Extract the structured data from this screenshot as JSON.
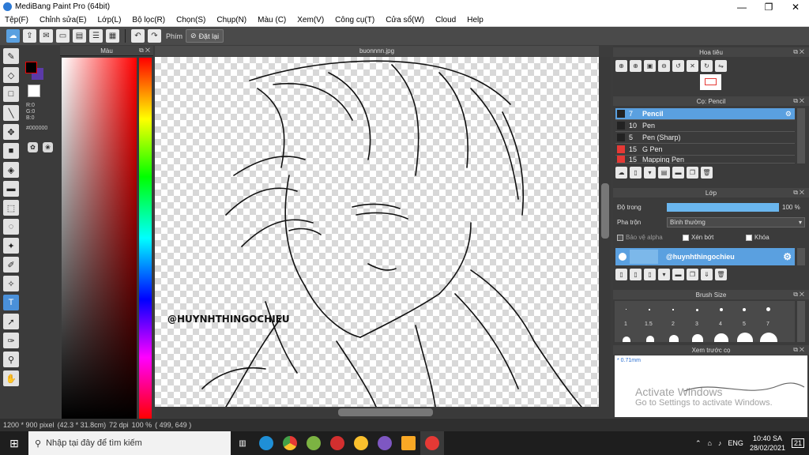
{
  "window": {
    "title": "MediBang Paint Pro (64bit)",
    "minimize": "—",
    "maximize": "❐",
    "close": "✕"
  },
  "menu": [
    "Tệp(F)",
    "Chỉnh sửa(E)",
    "Lớp(L)",
    "Bộ lọc(R)",
    "Chọn(S)",
    "Chụp(N)",
    "Màu (C)",
    "Xem(V)",
    "Công cụ(T)",
    "Cửa sổ(W)",
    "Cloud",
    "Help"
  ],
  "toolbar": {
    "mode_label": "Phím",
    "reset_label": "Đặt lại"
  },
  "color_panel": {
    "title": "Màu",
    "r": "R:0",
    "g": "G:0",
    "b": "B:0",
    "hex": "#000000"
  },
  "canvas": {
    "tab_title": "buonnnn.jpg",
    "signature": "@HUYNHTHINGOCHIEU"
  },
  "status": {
    "size": "1200 * 900 pixel",
    "cm": "(42.3 * 31.8cm)",
    "dpi": "72 dpi",
    "zoom": "100 %",
    "coords": "( 499, 649 )"
  },
  "navigator": {
    "title": "Hoa tiêu"
  },
  "brush_panel": {
    "title": "Cọ: Pencil",
    "brushes": [
      {
        "size": "7",
        "name": "Pencil",
        "color": "#e53935",
        "selected": true
      },
      {
        "size": "10",
        "name": "Pen",
        "color": "#222222",
        "selected": false
      },
      {
        "size": "5",
        "name": "Pen (Sharp)",
        "color": "#222222",
        "selected": false
      },
      {
        "size": "15",
        "name": "G Pen",
        "color": "#e53935",
        "selected": false
      },
      {
        "size": "15",
        "name": "Mapping Pen",
        "color": "#e53935",
        "selected": false
      }
    ]
  },
  "layer_panel": {
    "title": "Lớp",
    "opacity_label": "Độ trong",
    "opacity_value": "100 %",
    "opacity": 1.0,
    "blend_label": "Pha trộn",
    "blend_value": "Bình thường",
    "protect_alpha": "Bảo vệ alpha",
    "clipping": "Xén bớt",
    "lock": "Khóa",
    "layer_name": "@huynhthingochieu"
  },
  "brush_size": {
    "title": "Brush Size",
    "sizes": [
      "1",
      "1.5",
      "2",
      "3",
      "4",
      "5",
      "7"
    ]
  },
  "preview": {
    "title": "Xem trước cọ",
    "size_label": "* 0.71mm"
  },
  "activation": {
    "line1": "Activate Windows",
    "line2": "Go to Settings to activate Windows."
  },
  "taskbar": {
    "search_placeholder": "Nhập tại đây để tìm kiếm",
    "time": "10:40 SA",
    "date": "28/02/2021",
    "lang": "ENG",
    "notif": "21"
  }
}
